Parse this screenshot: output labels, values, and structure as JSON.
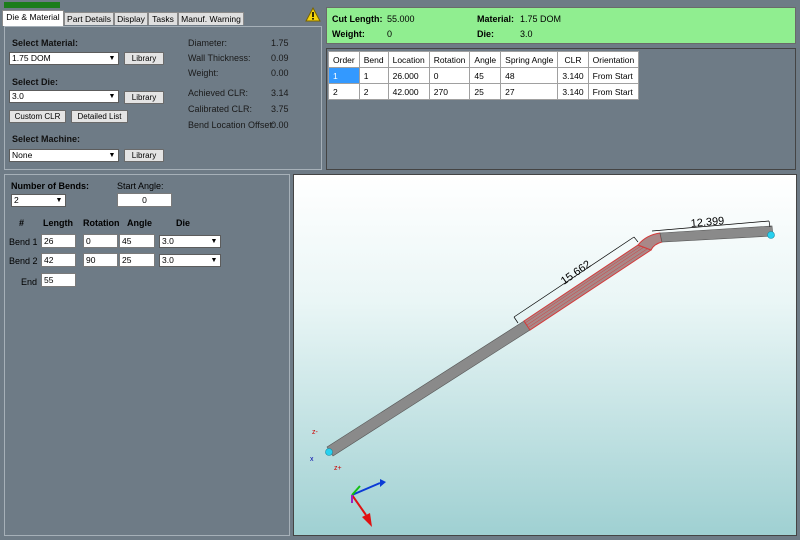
{
  "tabs": [
    "Die & Material",
    "Part Details",
    "Display",
    "Tasks",
    "Manuf. Warning"
  ],
  "material": {
    "label": "Select Material:",
    "value": "1.75 DOM",
    "library": "Library"
  },
  "die": {
    "label": "Select Die:",
    "value": "3.0",
    "library": "Library",
    "custom_clr": "Custom CLR",
    "detailed_list": "Detailed List"
  },
  "machine": {
    "label": "Select Machine:",
    "value": "None",
    "library": "Library"
  },
  "props": [
    {
      "label": "Diameter:",
      "value": "1.75"
    },
    {
      "label": "Wall Thickness:",
      "value": "0.09"
    },
    {
      "label": "Weight:",
      "value": "0.00"
    },
    {
      "label": "Achieved CLR:",
      "value": "3.14"
    },
    {
      "label": "Calibrated CLR:",
      "value": "3.75"
    },
    {
      "label": "Bend Location Offset:",
      "value": "0.00"
    }
  ],
  "summary": {
    "cut_length_label": "Cut Length:",
    "cut_length": "55.000",
    "weight_label": "Weight:",
    "weight": "0",
    "material_label": "Material:",
    "material": "1.75 DOM",
    "die_label": "Die:",
    "die": "3.0"
  },
  "grid": {
    "headers": [
      "Order",
      "Bend",
      "Location",
      "Rotation",
      "Angle",
      "Spring Angle",
      "CLR",
      "Orientation"
    ],
    "rows": [
      [
        "1",
        "1",
        "26.000",
        "0",
        "45",
        "48",
        "3.140",
        "From Start"
      ],
      [
        "2",
        "2",
        "42.000",
        "270",
        "25",
        "27",
        "3.140",
        "From Start"
      ]
    ]
  },
  "bends": {
    "num_label": "Number of Bends:",
    "num_value": "2",
    "start_angle_label": "Start Angle:",
    "start_angle": "0",
    "headers": [
      "#",
      "Length",
      "Rotation",
      "Angle",
      "Die"
    ],
    "rows": [
      {
        "name": "Bend 1",
        "length": "26",
        "rotation": "0",
        "angle": "45",
        "die": "3.0"
      },
      {
        "name": "Bend 2",
        "length": "42",
        "rotation": "90",
        "angle": "25",
        "die": "3.0"
      }
    ],
    "end_label": "End",
    "end_value": "55"
  },
  "view": {
    "dim1": "15.662",
    "dim2": "12.399",
    "axis_zminus": "z-",
    "axis_x": "x",
    "axis_zplus": "z+"
  },
  "colors": {
    "progress": "#1c7d1c",
    "summary_bg": "#90ee90",
    "selection": "#3399ff",
    "tube": "#8a8a8a",
    "bend": "#d43a3a"
  }
}
